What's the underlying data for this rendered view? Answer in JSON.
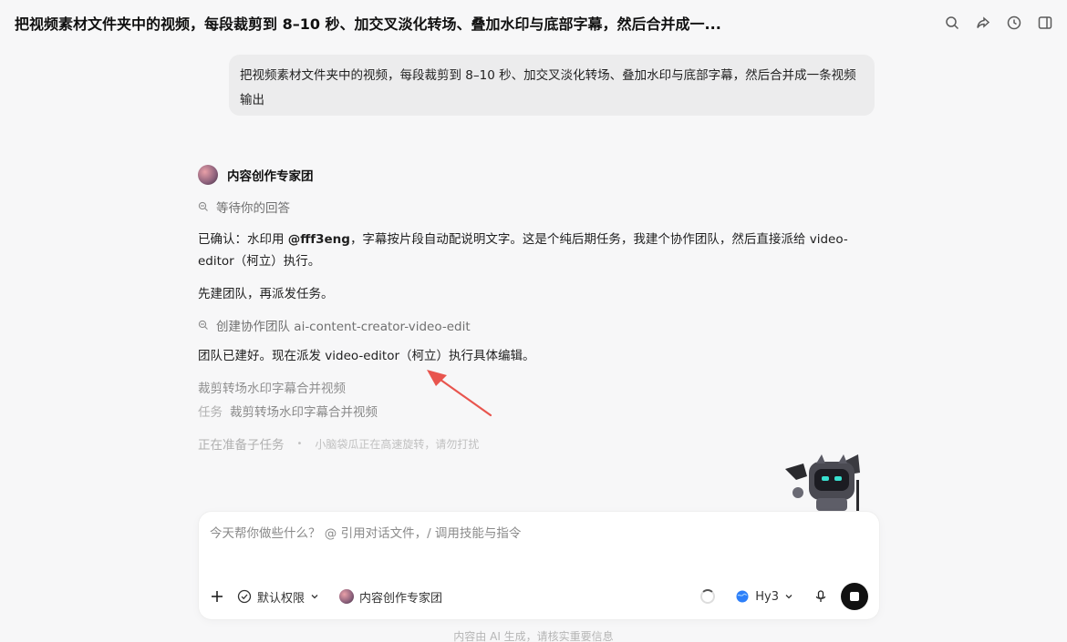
{
  "header": {
    "title": "把视频素材文件夹中的视频，每段裁剪到 8–10 秒、加交叉淡化转场、叠加水印与底部字幕，然后合并成一...",
    "icons": [
      "search-icon",
      "share-icon",
      "history-icon",
      "panel-icon"
    ]
  },
  "user_message": {
    "text": "把视频素材文件夹中的视频，每段裁剪到 8–10 秒、加交叉淡化转场、叠加水印与底部字幕，然后合并成一条视频输出"
  },
  "assistant": {
    "name": "内容创作专家团",
    "status_waiting": "等待你的回答",
    "para1_prefix": "已确认：水印用 ",
    "para1_handle": "@fff3eng",
    "para1_suffix": "，字幕按片段自动配说明文字。这是个纯后期任务，我建个协作团队，然后直接派给 video-editor（柯立）执行。",
    "para2": "先建团队，再派发任务。",
    "status_team": "创建协作团队 ai-content-creator-video-edit",
    "para3": "团队已建好。现在派发 video-editor（柯立）执行具体编辑。",
    "task_title": "裁剪转场水印字幕合并视频",
    "task_label": "任务",
    "task_name": "裁剪转场水印字幕合并视频",
    "preparing": "正在准备子任务",
    "dot": "•",
    "preparing_note": "小脑袋瓜正在高速旋转，请勿打扰"
  },
  "composer": {
    "placeholder": "今天帮你做些什么？ @ 引用对话文件，/ 调用技能与指令",
    "permission_label": "默认权限",
    "agent_label": "内容创作专家团",
    "model_label": "Hy3"
  },
  "footer": {
    "note": "内容由 AI 生成，请核实重要信息"
  },
  "colors": {
    "annotation_arrow": "#e8554e",
    "stop_button": "#111111"
  }
}
